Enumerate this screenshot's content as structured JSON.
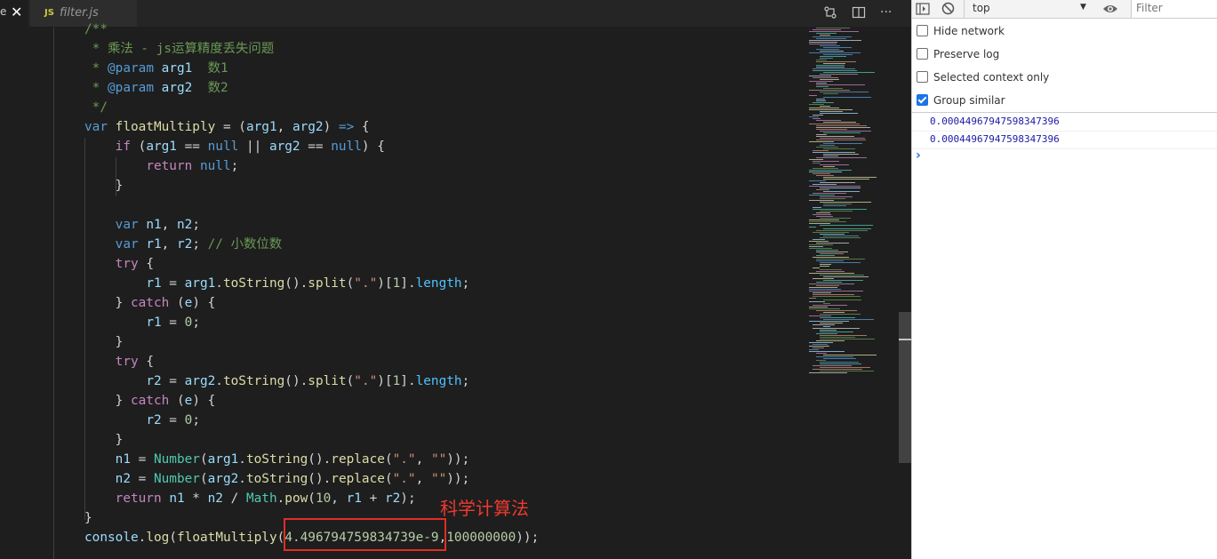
{
  "editor": {
    "tabs": [
      {
        "label": "e",
        "active": false
      },
      {
        "label": "filter.js",
        "active": true,
        "icon": "js-file-icon",
        "icon_text": "JS"
      }
    ],
    "toolbar_icons": [
      "compare-changes-icon",
      "split-editor-icon",
      "more-actions-icon"
    ],
    "more_label": "···",
    "code_lines": [
      [
        {
          "t": "/**",
          "c": "#6a9955"
        }
      ],
      [
        {
          "t": " * 乘法 - js运算精度丢失问题",
          "c": "#6a9955"
        }
      ],
      [
        {
          "t": " * ",
          "c": "#6a9955"
        },
        {
          "t": "@param",
          "c": "#569cd6"
        },
        {
          "t": " ",
          "c": "#6a9955"
        },
        {
          "t": "arg1",
          "c": "#9cdcfe"
        },
        {
          "t": "  数1",
          "c": "#6a9955"
        }
      ],
      [
        {
          "t": " * ",
          "c": "#6a9955"
        },
        {
          "t": "@param",
          "c": "#569cd6"
        },
        {
          "t": " ",
          "c": "#6a9955"
        },
        {
          "t": "arg2",
          "c": "#9cdcfe"
        },
        {
          "t": "  数2",
          "c": "#6a9955"
        }
      ],
      [
        {
          "t": " */",
          "c": "#6a9955"
        }
      ],
      [
        {
          "t": "var ",
          "c": "#569cd6"
        },
        {
          "t": "floatMultiply",
          "c": "#dcdcaa"
        },
        {
          "t": " = (",
          "c": "#d4d4d4"
        },
        {
          "t": "arg1",
          "c": "#9cdcfe"
        },
        {
          "t": ", ",
          "c": "#d4d4d4"
        },
        {
          "t": "arg2",
          "c": "#9cdcfe"
        },
        {
          "t": ") ",
          "c": "#d4d4d4"
        },
        {
          "t": "=>",
          "c": "#569cd6"
        },
        {
          "t": " {",
          "c": "#d4d4d4"
        }
      ],
      [
        {
          "t": "    ",
          "c": "#d4d4d4"
        },
        {
          "t": "if",
          "c": "#c586c0"
        },
        {
          "t": " (",
          "c": "#d4d4d4"
        },
        {
          "t": "arg1",
          "c": "#9cdcfe"
        },
        {
          "t": " == ",
          "c": "#d4d4d4"
        },
        {
          "t": "null",
          "c": "#569cd6"
        },
        {
          "t": " || ",
          "c": "#d4d4d4"
        },
        {
          "t": "arg2",
          "c": "#9cdcfe"
        },
        {
          "t": " == ",
          "c": "#d4d4d4"
        },
        {
          "t": "null",
          "c": "#569cd6"
        },
        {
          "t": ") {",
          "c": "#d4d4d4"
        }
      ],
      [
        {
          "t": "        ",
          "c": "#d4d4d4"
        },
        {
          "t": "return",
          "c": "#c586c0"
        },
        {
          "t": " ",
          "c": "#d4d4d4"
        },
        {
          "t": "null",
          "c": "#569cd6"
        },
        {
          "t": ";",
          "c": "#d4d4d4"
        }
      ],
      [
        {
          "t": "    }",
          "c": "#d4d4d4"
        }
      ],
      [
        {
          "t": "",
          "c": "#d4d4d4"
        }
      ],
      [
        {
          "t": "    ",
          "c": "#d4d4d4"
        },
        {
          "t": "var",
          "c": "#569cd6"
        },
        {
          "t": " ",
          "c": "#d4d4d4"
        },
        {
          "t": "n1",
          "c": "#9cdcfe"
        },
        {
          "t": ", ",
          "c": "#d4d4d4"
        },
        {
          "t": "n2",
          "c": "#9cdcfe"
        },
        {
          "t": ";",
          "c": "#d4d4d4"
        }
      ],
      [
        {
          "t": "    ",
          "c": "#d4d4d4"
        },
        {
          "t": "var",
          "c": "#569cd6"
        },
        {
          "t": " ",
          "c": "#d4d4d4"
        },
        {
          "t": "r1",
          "c": "#9cdcfe"
        },
        {
          "t": ", ",
          "c": "#d4d4d4"
        },
        {
          "t": "r2",
          "c": "#9cdcfe"
        },
        {
          "t": "; ",
          "c": "#d4d4d4"
        },
        {
          "t": "// 小数位数",
          "c": "#6a9955"
        }
      ],
      [
        {
          "t": "    ",
          "c": "#d4d4d4"
        },
        {
          "t": "try",
          "c": "#c586c0"
        },
        {
          "t": " {",
          "c": "#d4d4d4"
        }
      ],
      [
        {
          "t": "        ",
          "c": "#d4d4d4"
        },
        {
          "t": "r1",
          "c": "#9cdcfe"
        },
        {
          "t": " = ",
          "c": "#d4d4d4"
        },
        {
          "t": "arg1",
          "c": "#9cdcfe"
        },
        {
          "t": ".",
          "c": "#d4d4d4"
        },
        {
          "t": "toString",
          "c": "#dcdcaa"
        },
        {
          "t": "().",
          "c": "#d4d4d4"
        },
        {
          "t": "split",
          "c": "#dcdcaa"
        },
        {
          "t": "(",
          "c": "#d4d4d4"
        },
        {
          "t": "\".\"",
          "c": "#ce9178"
        },
        {
          "t": ")[",
          "c": "#d4d4d4"
        },
        {
          "t": "1",
          "c": "#b5cea8"
        },
        {
          "t": "].",
          "c": "#d4d4d4"
        },
        {
          "t": "length",
          "c": "#4fc1ff"
        },
        {
          "t": ";",
          "c": "#d4d4d4"
        }
      ],
      [
        {
          "t": "    } ",
          "c": "#d4d4d4"
        },
        {
          "t": "catch",
          "c": "#c586c0"
        },
        {
          "t": " (",
          "c": "#d4d4d4"
        },
        {
          "t": "e",
          "c": "#9cdcfe"
        },
        {
          "t": ") {",
          "c": "#d4d4d4"
        }
      ],
      [
        {
          "t": "        ",
          "c": "#d4d4d4"
        },
        {
          "t": "r1",
          "c": "#9cdcfe"
        },
        {
          "t": " = ",
          "c": "#d4d4d4"
        },
        {
          "t": "0",
          "c": "#b5cea8"
        },
        {
          "t": ";",
          "c": "#d4d4d4"
        }
      ],
      [
        {
          "t": "    }",
          "c": "#d4d4d4"
        }
      ],
      [
        {
          "t": "    ",
          "c": "#d4d4d4"
        },
        {
          "t": "try",
          "c": "#c586c0"
        },
        {
          "t": " {",
          "c": "#d4d4d4"
        }
      ],
      [
        {
          "t": "        ",
          "c": "#d4d4d4"
        },
        {
          "t": "r2",
          "c": "#9cdcfe"
        },
        {
          "t": " = ",
          "c": "#d4d4d4"
        },
        {
          "t": "arg2",
          "c": "#9cdcfe"
        },
        {
          "t": ".",
          "c": "#d4d4d4"
        },
        {
          "t": "toString",
          "c": "#dcdcaa"
        },
        {
          "t": "().",
          "c": "#d4d4d4"
        },
        {
          "t": "split",
          "c": "#dcdcaa"
        },
        {
          "t": "(",
          "c": "#d4d4d4"
        },
        {
          "t": "\".\"",
          "c": "#ce9178"
        },
        {
          "t": ")[",
          "c": "#d4d4d4"
        },
        {
          "t": "1",
          "c": "#b5cea8"
        },
        {
          "t": "].",
          "c": "#d4d4d4"
        },
        {
          "t": "length",
          "c": "#4fc1ff"
        },
        {
          "t": ";",
          "c": "#d4d4d4"
        }
      ],
      [
        {
          "t": "    } ",
          "c": "#d4d4d4"
        },
        {
          "t": "catch",
          "c": "#c586c0"
        },
        {
          "t": " (",
          "c": "#d4d4d4"
        },
        {
          "t": "e",
          "c": "#9cdcfe"
        },
        {
          "t": ") {",
          "c": "#d4d4d4"
        }
      ],
      [
        {
          "t": "        ",
          "c": "#d4d4d4"
        },
        {
          "t": "r2",
          "c": "#9cdcfe"
        },
        {
          "t": " = ",
          "c": "#d4d4d4"
        },
        {
          "t": "0",
          "c": "#b5cea8"
        },
        {
          "t": ";",
          "c": "#d4d4d4"
        }
      ],
      [
        {
          "t": "    }",
          "c": "#d4d4d4"
        }
      ],
      [
        {
          "t": "    ",
          "c": "#d4d4d4"
        },
        {
          "t": "n1",
          "c": "#9cdcfe"
        },
        {
          "t": " = ",
          "c": "#d4d4d4"
        },
        {
          "t": "Number",
          "c": "#4ec9b0"
        },
        {
          "t": "(",
          "c": "#d4d4d4"
        },
        {
          "t": "arg1",
          "c": "#9cdcfe"
        },
        {
          "t": ".",
          "c": "#d4d4d4"
        },
        {
          "t": "toString",
          "c": "#dcdcaa"
        },
        {
          "t": "().",
          "c": "#d4d4d4"
        },
        {
          "t": "replace",
          "c": "#dcdcaa"
        },
        {
          "t": "(",
          "c": "#d4d4d4"
        },
        {
          "t": "\".\"",
          "c": "#ce9178"
        },
        {
          "t": ", ",
          "c": "#d4d4d4"
        },
        {
          "t": "\"\"",
          "c": "#ce9178"
        },
        {
          "t": "));",
          "c": "#d4d4d4"
        }
      ],
      [
        {
          "t": "    ",
          "c": "#d4d4d4"
        },
        {
          "t": "n2",
          "c": "#9cdcfe"
        },
        {
          "t": " = ",
          "c": "#d4d4d4"
        },
        {
          "t": "Number",
          "c": "#4ec9b0"
        },
        {
          "t": "(",
          "c": "#d4d4d4"
        },
        {
          "t": "arg2",
          "c": "#9cdcfe"
        },
        {
          "t": ".",
          "c": "#d4d4d4"
        },
        {
          "t": "toString",
          "c": "#dcdcaa"
        },
        {
          "t": "().",
          "c": "#d4d4d4"
        },
        {
          "t": "replace",
          "c": "#dcdcaa"
        },
        {
          "t": "(",
          "c": "#d4d4d4"
        },
        {
          "t": "\".\"",
          "c": "#ce9178"
        },
        {
          "t": ", ",
          "c": "#d4d4d4"
        },
        {
          "t": "\"\"",
          "c": "#ce9178"
        },
        {
          "t": "));",
          "c": "#d4d4d4"
        }
      ],
      [
        {
          "t": "    ",
          "c": "#d4d4d4"
        },
        {
          "t": "return",
          "c": "#c586c0"
        },
        {
          "t": " ",
          "c": "#d4d4d4"
        },
        {
          "t": "n1",
          "c": "#9cdcfe"
        },
        {
          "t": " * ",
          "c": "#d4d4d4"
        },
        {
          "t": "n2",
          "c": "#9cdcfe"
        },
        {
          "t": " / ",
          "c": "#d4d4d4"
        },
        {
          "t": "Math",
          "c": "#4ec9b0"
        },
        {
          "t": ".",
          "c": "#d4d4d4"
        },
        {
          "t": "pow",
          "c": "#dcdcaa"
        },
        {
          "t": "(",
          "c": "#d4d4d4"
        },
        {
          "t": "10",
          "c": "#b5cea8"
        },
        {
          "t": ", ",
          "c": "#d4d4d4"
        },
        {
          "t": "r1",
          "c": "#9cdcfe"
        },
        {
          "t": " + ",
          "c": "#d4d4d4"
        },
        {
          "t": "r2",
          "c": "#9cdcfe"
        },
        {
          "t": ");",
          "c": "#d4d4d4"
        }
      ],
      [
        {
          "t": "}",
          "c": "#d4d4d4"
        }
      ],
      [
        {
          "t": "console",
          "c": "#9cdcfe"
        },
        {
          "t": ".",
          "c": "#d4d4d4"
        },
        {
          "t": "log",
          "c": "#dcdcaa"
        },
        {
          "t": "(",
          "c": "#d4d4d4"
        },
        {
          "t": "floatMultiply",
          "c": "#dcdcaa"
        },
        {
          "t": "(",
          "c": "#d4d4d4"
        },
        {
          "t": "4.496794759834739e-9",
          "c": "#b5cea8"
        },
        {
          "t": ",",
          "c": "#d4d4d4"
        },
        {
          "t": "100000000",
          "c": "#b5cea8"
        },
        {
          "t": "));",
          "c": "#d4d4d4"
        }
      ]
    ],
    "annotation": {
      "label": "科学计算法",
      "color": "#e02e24"
    }
  },
  "devtools": {
    "context": "top",
    "filter_placeholder": "Filter",
    "icons": [
      "sidebar-toggle-icon",
      "clear-console-icon",
      "dropdown-arrow-icon",
      "eye-icon"
    ],
    "options": [
      {
        "label": "Hide network",
        "checked": false
      },
      {
        "label": "Preserve log",
        "checked": false
      },
      {
        "label": "Selected context only",
        "checked": false
      },
      {
        "label": "Group similar",
        "checked": true
      }
    ],
    "logs": [
      "0.00044967947598347396",
      "0.00044967947598347396"
    ],
    "prompt": "›"
  }
}
